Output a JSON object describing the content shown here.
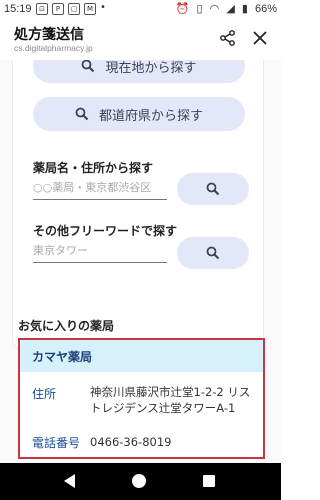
{
  "status": {
    "time": "15:19",
    "left_icons": [
      "⊡",
      "P",
      "▢",
      "M",
      "•"
    ],
    "battery": "66%"
  },
  "appbar": {
    "title": "処方箋送信",
    "url": "cs.digitalpharmacy.jp"
  },
  "search": {
    "current_location_label": "現在地から探す",
    "prefecture_label": "都道府県から探す",
    "name_address_title": "薬局名・住所から探す",
    "name_address_placeholder": "○○薬局・東京都渋谷区",
    "freeword_title": "その他フリーワードで探す",
    "freeword_placeholder": "東京タワー"
  },
  "favorites": {
    "title": "お気に入りの薬局",
    "pharmacy": {
      "name": "カマヤ薬局",
      "address_label": "住所",
      "address": "神奈川県藤沢市辻堂1-2-2 リストレジデンス辻堂タワーA-1",
      "phone_label": "電話番号",
      "phone": "0466-36-8019"
    }
  },
  "colors": {
    "accent_pill": "#e3e8f9",
    "highlight_border": "#c8343f",
    "card_header": "#d6f1fb"
  }
}
